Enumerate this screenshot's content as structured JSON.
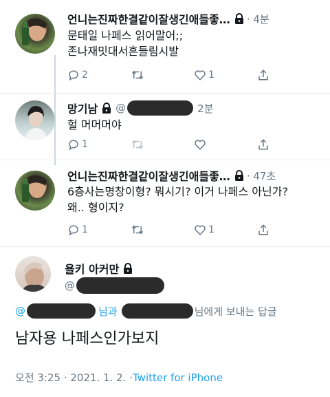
{
  "tweets": [
    {
      "name": "언니는진짜한결같이잘생긴애들좋…",
      "time": "· 4분",
      "lines": [
        "문태일 나페스 읽어말어;;",
        "존나재밋대서흔들림시발"
      ],
      "reply_count": "2",
      "retweet_count": "",
      "like_count": "1"
    },
    {
      "name": "망기남",
      "time": "2분",
      "lines": [
        "헐 머머머야"
      ],
      "reply_count": "1",
      "retweet_count": "",
      "like_count": ""
    },
    {
      "name": "언니는진짜한결같이잘생긴애들좋…",
      "time": "· 47초",
      "lines": [
        "6층사는명창이형? 뭐시기? 이거 나페스 아닌가?",
        "왜.. 형이지?"
      ],
      "reply_count": "1",
      "retweet_count": "",
      "like_count": "1"
    }
  ],
  "main_tweet": {
    "name": "욜키 아커만",
    "handle_prefix": "@",
    "reply_prefix": "@",
    "reply_and": "님과",
    "reply_suffix": "님에게 보내는 답글",
    "body": "남자용 나페스인가보지",
    "timestamp": "오전 3:25 · 2021. 1. 2. · ",
    "source": "Twitter for iPhone"
  },
  "colors": {
    "accent": "#1da1f2",
    "muted": "#657786",
    "text": "#14171a"
  }
}
